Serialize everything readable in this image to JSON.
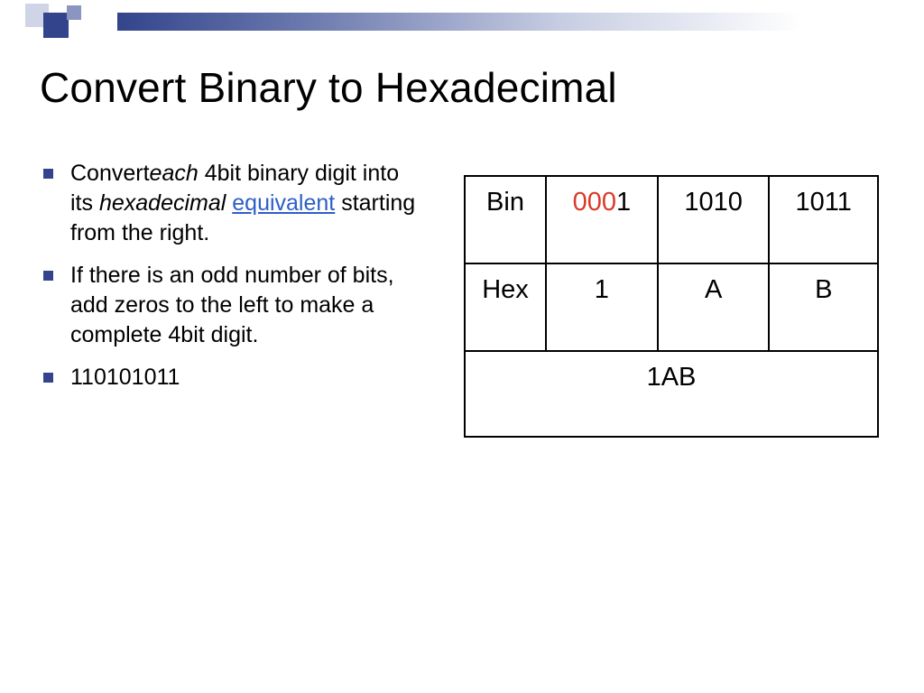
{
  "title": "Convert Binary to Hexadecimal",
  "bullets": {
    "b1": {
      "t1": "Convert",
      "t2": "each",
      "t3": " 4bit binary digit into its ",
      "t4": "hexadecimal",
      "t5": " ",
      "t6": "equivalent",
      "t7": " starting from the right."
    },
    "b2": "If there is an odd number of bits, add zeros to the left to make a complete 4bit digit.",
    "b3": "110101011"
  },
  "table": {
    "r1": {
      "c0": "Bin",
      "c1a": "000",
      "c1b": "1",
      "c2": "1010",
      "c3": "1011"
    },
    "r2": {
      "c0": "Hex",
      "c1": "1",
      "c2": "A",
      "c3": "B"
    },
    "r3": "1AB"
  }
}
